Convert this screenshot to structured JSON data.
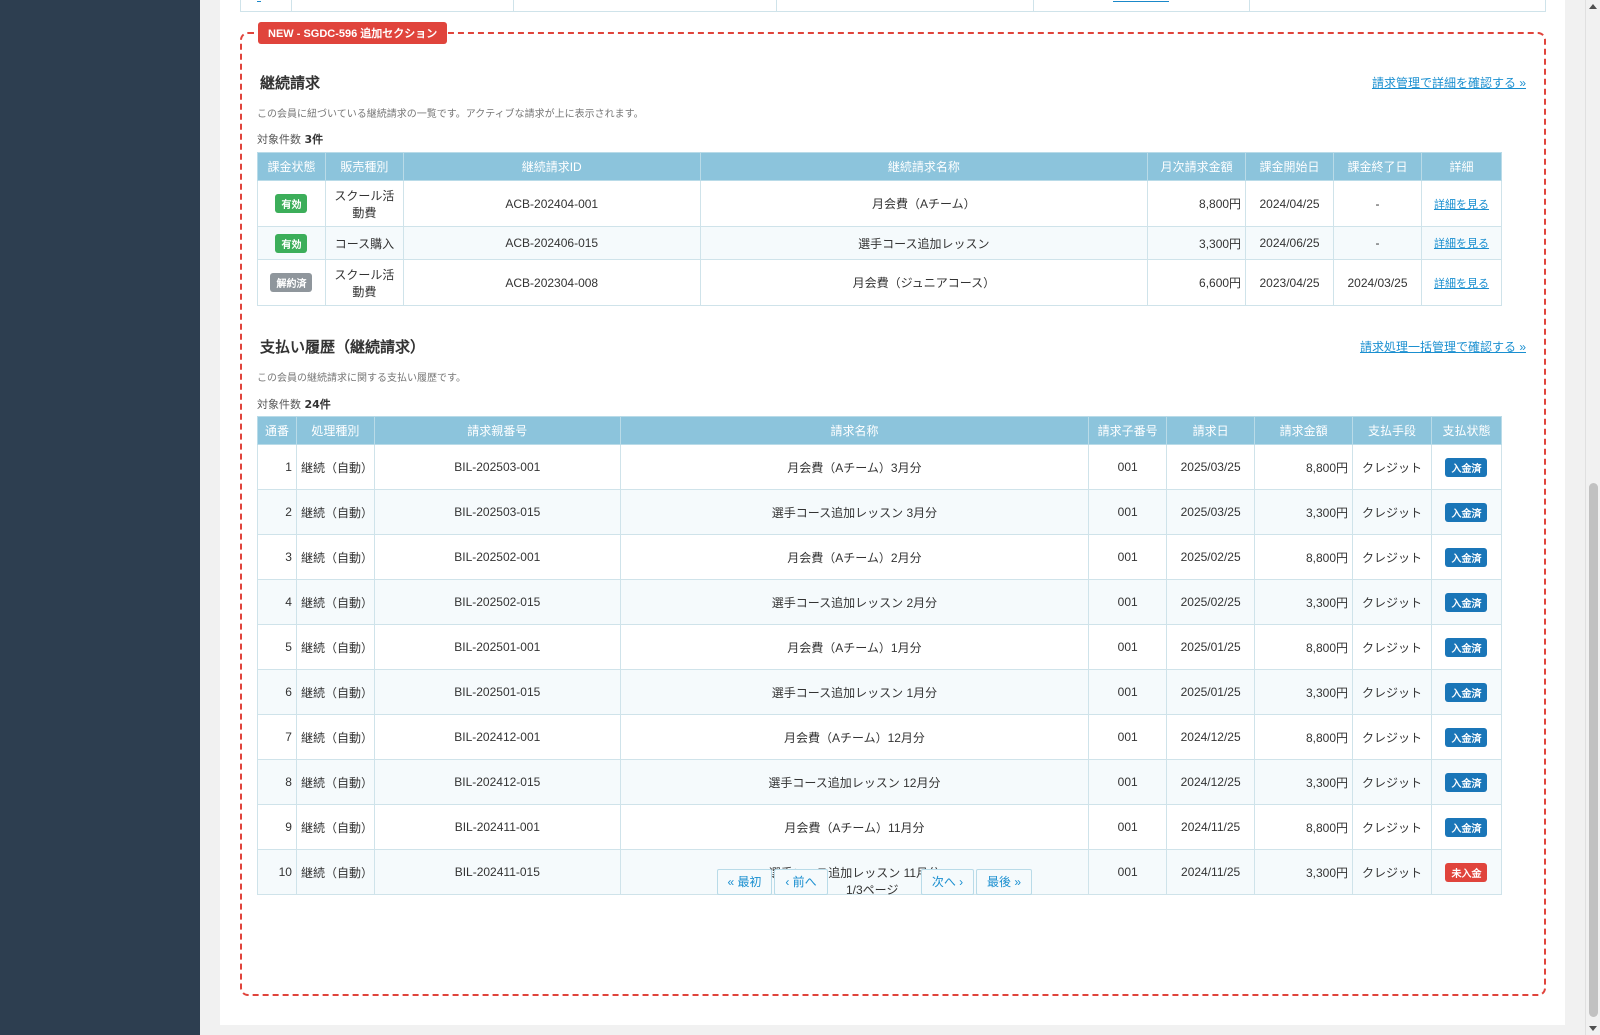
{
  "badge": "NEW - SGDC-596 追加セクション",
  "continuous": {
    "title": "継続請求",
    "link": "請求管理で詳細を確認する »",
    "description": "この会員に紐づいている継続請求の一覧です。アクティブな請求が上に表示されます。",
    "count_label": "対象件数",
    "count_value": "3件",
    "headers": [
      "課金状態",
      "販売種別",
      "継続請求ID",
      "継続請求名称",
      "月次請求金額",
      "課金開始日",
      "課金終了日",
      "詳細"
    ],
    "rows": [
      {
        "status": "有効",
        "status_color": "#3cae5a",
        "type": "スクール活動費",
        "id": "ACB-202404-001",
        "name": "月会費（Aチーム）",
        "amount": "8,800円",
        "start": "2024/04/25",
        "end": "-",
        "detail": "詳細を見る"
      },
      {
        "status": "有効",
        "status_color": "#3cae5a",
        "type": "コース購入",
        "id": "ACB-202406-015",
        "name": "選手コース追加レッスン",
        "amount": "3,300円",
        "start": "2024/06/25",
        "end": "-",
        "detail": "詳細を見る"
      },
      {
        "status": "解約済",
        "status_color": "#8f969c",
        "type": "スクール活動費",
        "id": "ACB-202304-008",
        "name": "月会費（ジュニアコース）",
        "amount": "6,600円",
        "start": "2023/04/25",
        "end": "2024/03/25",
        "detail": "詳細を見る"
      }
    ]
  },
  "payments": {
    "title": "支払い履歴（継続請求）",
    "link": "請求処理一括管理で確認する »",
    "description": "この会員の継続請求に関する支払い履歴です。",
    "count_label": "対象件数",
    "count_value": "24件",
    "headers": [
      "通番",
      "処理種別",
      "請求親番号",
      "請求名称",
      "請求子番号",
      "請求日",
      "請求金額",
      "支払手段",
      "支払状態"
    ],
    "rows": [
      {
        "no": "1",
        "kind": "継続（自動）",
        "parent": "BIL-202503-001",
        "name": "月会費（Aチーム）3月分",
        "child": "001",
        "date": "2025/03/25",
        "amount": "8,800円",
        "method": "クレジット",
        "state": "入金済",
        "state_color": "#1a76b8"
      },
      {
        "no": "2",
        "kind": "継続（自動）",
        "parent": "BIL-202503-015",
        "name": "選手コース追加レッスン 3月分",
        "child": "001",
        "date": "2025/03/25",
        "amount": "3,300円",
        "method": "クレジット",
        "state": "入金済",
        "state_color": "#1a76b8"
      },
      {
        "no": "3",
        "kind": "継続（自動）",
        "parent": "BIL-202502-001",
        "name": "月会費（Aチーム）2月分",
        "child": "001",
        "date": "2025/02/25",
        "amount": "8,800円",
        "method": "クレジット",
        "state": "入金済",
        "state_color": "#1a76b8"
      },
      {
        "no": "4",
        "kind": "継続（自動）",
        "parent": "BIL-202502-015",
        "name": "選手コース追加レッスン 2月分",
        "child": "001",
        "date": "2025/02/25",
        "amount": "3,300円",
        "method": "クレジット",
        "state": "入金済",
        "state_color": "#1a76b8"
      },
      {
        "no": "5",
        "kind": "継続（自動）",
        "parent": "BIL-202501-001",
        "name": "月会費（Aチーム）1月分",
        "child": "001",
        "date": "2025/01/25",
        "amount": "8,800円",
        "method": "クレジット",
        "state": "入金済",
        "state_color": "#1a76b8"
      },
      {
        "no": "6",
        "kind": "継続（自動）",
        "parent": "BIL-202501-015",
        "name": "選手コース追加レッスン 1月分",
        "child": "001",
        "date": "2025/01/25",
        "amount": "3,300円",
        "method": "クレジット",
        "state": "入金済",
        "state_color": "#1a76b8"
      },
      {
        "no": "7",
        "kind": "継続（自動）",
        "parent": "BIL-202412-001",
        "name": "月会費（Aチーム）12月分",
        "child": "001",
        "date": "2024/12/25",
        "amount": "8,800円",
        "method": "クレジット",
        "state": "入金済",
        "state_color": "#1a76b8"
      },
      {
        "no": "8",
        "kind": "継続（自動）",
        "parent": "BIL-202412-015",
        "name": "選手コース追加レッスン 12月分",
        "child": "001",
        "date": "2024/12/25",
        "amount": "3,300円",
        "method": "クレジット",
        "state": "入金済",
        "state_color": "#1a76b8"
      },
      {
        "no": "9",
        "kind": "継続（自動）",
        "parent": "BIL-202411-001",
        "name": "月会費（Aチーム）11月分",
        "child": "001",
        "date": "2024/11/25",
        "amount": "8,800円",
        "method": "クレジット",
        "state": "入金済",
        "state_color": "#1a76b8"
      },
      {
        "no": "10",
        "kind": "継続（自動）",
        "parent": "BIL-202411-015",
        "name": "選手コース追加レッスン 11月分",
        "child": "001",
        "date": "2024/11/25",
        "amount": "3,300円",
        "method": "クレジット",
        "state": "未入金",
        "state_color": "#e0443c"
      }
    ]
  },
  "pager": {
    "first": "« 最初",
    "prev": "‹ 前へ",
    "info": "1/3ページ",
    "next": "次へ ›",
    "last": "最後 »"
  }
}
